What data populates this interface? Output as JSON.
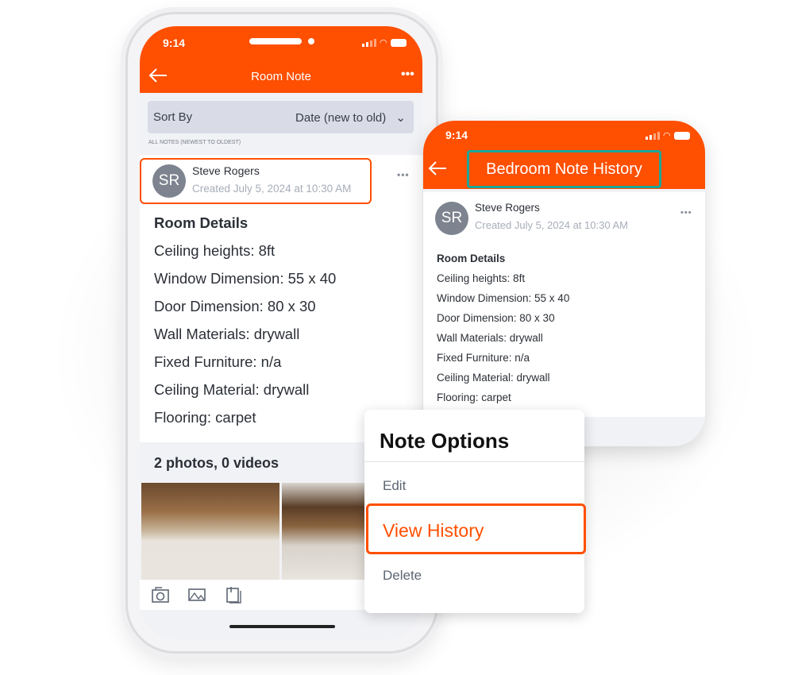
{
  "colors": {
    "brand": "#ff4f00",
    "highlight_teal": "#1aa79a"
  },
  "phone_main": {
    "status_time": "9:14",
    "header": {
      "back_icon": "arrow-left-icon",
      "title": "Room Note",
      "more_icon": "ellipsis-icon"
    },
    "sort": {
      "label": "Sort By",
      "value": "Date (new to old)"
    },
    "list_caption": "ALL NOTES (NEWEST TO OLDEST)",
    "note": {
      "avatar_initials": "SR",
      "author": "Steve Rogers",
      "created": "Created July 5, 2024 at 10:30 AM",
      "heading": "Room Details",
      "lines": [
        "Ceiling heights: 8ft",
        "Window Dimension: 55 x 40",
        "Door Dimension: 80 x 30",
        "Wall Materials: drywall",
        "Fixed Furniture: n/a",
        "Ceiling Material: drywall",
        "Flooring: carpet"
      ]
    },
    "media_summary": "2 photos, 0 videos",
    "toolbar": [
      "camera-icon",
      "image-icon",
      "clipboard-icon"
    ]
  },
  "phone_history": {
    "status_time": "9:14",
    "title": "Bedroom Note History",
    "note": {
      "avatar_initials": "SR",
      "author": "Steve Rogers",
      "created": "Created July 5, 2024 at 10:30 AM",
      "heading": "Room Details",
      "lines": [
        "Ceiling heights: 8ft",
        "Window Dimension: 55 x 40",
        "Door Dimension: 80 x 30",
        "Wall Materials: drywall",
        "Fixed Furniture: n/a",
        "Ceiling Material: drywall",
        "Flooring: carpet"
      ]
    }
  },
  "menu": {
    "title": "Note Options",
    "items": [
      "Edit",
      "View History",
      "Delete"
    ]
  }
}
